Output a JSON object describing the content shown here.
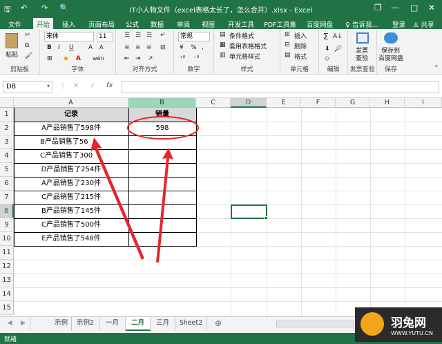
{
  "window": {
    "title": "IT小人物文件（excel表格太长了，怎么合并）.xlsx - Excel",
    "restore_glyph": "❐",
    "minimize_glyph": "—",
    "maximize_glyph": "□",
    "close_glyph": "✕",
    "save_glyph": "🖫",
    "undo_glyph": "↶",
    "redo_glyph": "↷",
    "preview_glyph": "🔍"
  },
  "menu_tabs": [
    "文件",
    "开始",
    "插入",
    "页面布局",
    "公式",
    "数据",
    "审阅",
    "视图",
    "开发工具",
    "PDF工具集",
    "百度网盘"
  ],
  "tell_me": "♀ 告诉我...",
  "login": "登录",
  "share": "♙ 共享",
  "ribbon": {
    "paste": "粘贴",
    "font_name": "宋体",
    "font_size": "11",
    "number_format": "常规",
    "bold": "B",
    "italic": "I",
    "underline": "U",
    "grow_font": "A",
    "shrink_font": "A",
    "font_color": "A",
    "wen": "wén",
    "percent": "%",
    "comma": ",",
    "currency": "¥",
    "conditional_format": "条件格式",
    "table_format": "套用表格格式",
    "cell_style": "单元格样式",
    "insert": "插入",
    "delete": "删除",
    "format": "格式",
    "sum": "Σ",
    "sort": "A↓",
    "find": "🔎",
    "invoice_check_1": "发票",
    "invoice_check_2": "查验",
    "save_baidu_1": "保存到",
    "save_baidu_2": "百度网盘",
    "groups": [
      "剪贴板",
      "字体",
      "对齐方式",
      "数字",
      "样式",
      "单元格",
      "编辑",
      "发票查验",
      "保存"
    ]
  },
  "formula_bar": {
    "name_box": "D8",
    "cancel": "✕",
    "enter": "✓",
    "fx": "fx",
    "content": ""
  },
  "columns": [
    "A",
    "B",
    "C",
    "D",
    "E",
    "F",
    "G",
    "H",
    "I"
  ],
  "rows": [
    "1",
    "2",
    "3",
    "4",
    "5",
    "6",
    "7",
    "8",
    "9",
    "10",
    "11",
    "12",
    "13",
    "14",
    "15"
  ],
  "cells": {
    "A1": "记录",
    "B1": "销量",
    "B2": "598",
    "records": [
      "A产品销售了598件",
      "B产品销售了56",
      "C产品销售了300",
      "D产品销售了254件",
      "A产品销售了230件",
      "C产品销售了215件",
      "B产品销售了145件",
      "C产品销售了500件",
      "E产品销售了548件"
    ]
  },
  "sheet_tabs": [
    "示例",
    "示例2",
    "一月",
    "二月",
    "三月",
    "Sheet2"
  ],
  "active_sheet": "二月",
  "sheet_nav": {
    "prev": "◀",
    "next": "▶",
    "add": "⊕"
  },
  "status": "就绪",
  "annotation_color": "#e5262a",
  "watermark": {
    "text": "羽兔网",
    "url": "WWW.YUTU.CN"
  }
}
